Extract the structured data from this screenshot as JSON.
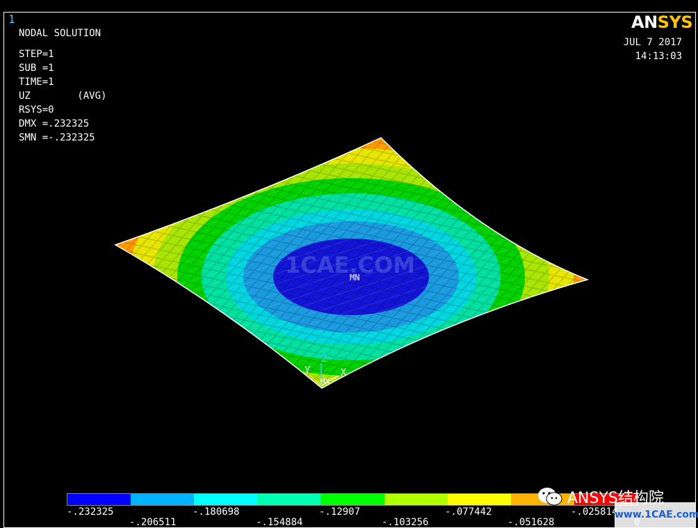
{
  "window": {
    "number": "1"
  },
  "logo": {
    "part1": "AN",
    "part2": "SYS"
  },
  "header": {
    "date": "JUL  7 2017",
    "time": "14:13:03"
  },
  "solution_info": [
    "NODAL SOLUTION",
    "STEP=1",
    "SUB =1",
    "TIME=1",
    "UZ        (AVG)",
    "RSYS=0",
    "DMX =.232325",
    "SMN =-.232325"
  ],
  "plot": {
    "min_label": "MN",
    "mx_label": "MX",
    "axes": {
      "x": "X",
      "y": "Y",
      "z": "Z"
    }
  },
  "legend": {
    "colors": [
      "#0000ff",
      "#00b2ff",
      "#00ffff",
      "#00ffb2",
      "#00ff00",
      "#b2ff00",
      "#ffff00",
      "#ffb200",
      "#ff0000"
    ],
    "top_labels": [
      "-.232325",
      "-.180698",
      "-.12907",
      "-.077442",
      "-.025814"
    ],
    "bottom_labels": [
      "-.206511",
      "-.154884",
      "-.103256",
      "-.051628",
      "0"
    ]
  },
  "watermarks": {
    "center": "1CAE.COM",
    "wechat": "ANSYS结构院",
    "site": "www.1CAE.com"
  }
}
